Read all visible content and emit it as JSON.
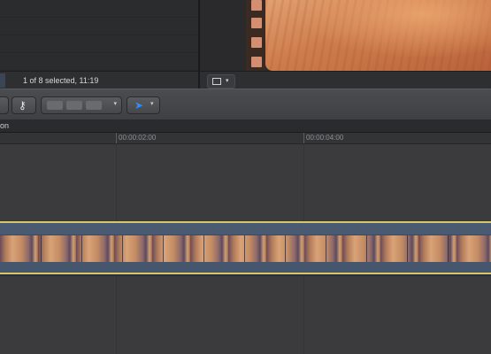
{
  "browser": {
    "status_text": "1 of 8 selected, 11:19"
  },
  "viewer": {
    "frame_button_caret": "▾"
  },
  "toolbar": {
    "key_icon": "key-icon",
    "tool_arrow": "▶",
    "tool_caret": "▾",
    "edit_caret": "▾"
  },
  "timeline": {
    "header_label": "on",
    "ruler": [
      "00:00:02:00",
      "00:00:04:00"
    ]
  },
  "colors": {
    "clip_border": "#d8c66a",
    "clip_body": "#4a5a70",
    "select_tool_accent": "#2d8cff"
  }
}
